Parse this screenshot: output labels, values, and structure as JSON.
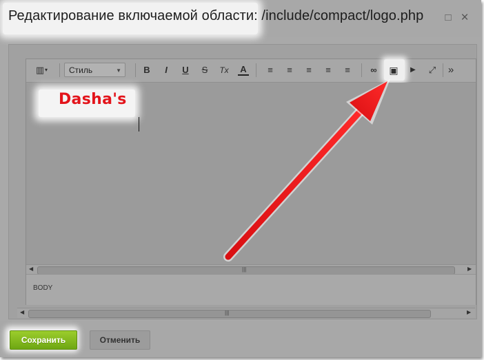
{
  "dialog": {
    "title": "Редактирование включаемой области: /include/compact/logo.php"
  },
  "window_controls": [
    {
      "name": "maximize-icon",
      "glyph": "□"
    },
    {
      "name": "close-icon",
      "glyph": "×"
    }
  ],
  "toolbar": {
    "style_select_value": "Стиль",
    "buttons": [
      {
        "name": "view-mode-icon",
        "glyph": "▥"
      },
      {
        "name": "bold-button",
        "glyph": "B"
      },
      {
        "name": "italic-button",
        "glyph": "I"
      },
      {
        "name": "underline-button",
        "glyph": "U"
      },
      {
        "name": "strikethrough-button",
        "glyph": "S"
      },
      {
        "name": "remove-format-button",
        "glyph": "Tx"
      },
      {
        "name": "font-color-button",
        "glyph": "A"
      },
      {
        "name": "ordered-list-icon",
        "glyph": "≡"
      },
      {
        "name": "unordered-list-icon",
        "glyph": "≡"
      },
      {
        "name": "indent-icon",
        "glyph": "≡"
      },
      {
        "name": "outdent-icon",
        "glyph": "≡"
      },
      {
        "name": "align-icon",
        "glyph": "≡"
      },
      {
        "name": "link-icon",
        "glyph": "∞"
      },
      {
        "name": "image-icon",
        "glyph": "▣"
      },
      {
        "name": "video-icon",
        "glyph": "▶"
      },
      {
        "name": "fullscreen-icon",
        "glyph": "⤢"
      },
      {
        "name": "more-icon",
        "glyph": "»"
      }
    ]
  },
  "editor": {
    "content_text": "Dasha's"
  },
  "status_bar": {
    "path_label": "BODY"
  },
  "footer": {
    "save_label": "Сохранить",
    "cancel_label": "Отменить"
  },
  "colors": {
    "annotation_red": "#e3141b",
    "save_green": "#7bb51a"
  }
}
